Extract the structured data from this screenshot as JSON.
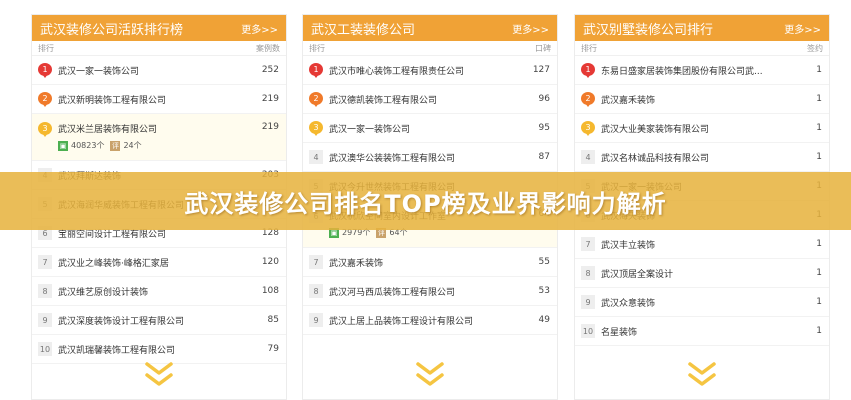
{
  "panels": [
    {
      "title": "武汉装修公司活跃排行榜",
      "more": "更多>>",
      "col_left": "排行",
      "col_right": "案例数",
      "rows": [
        {
          "rank": "1",
          "name": "武汉一家一装饰公司",
          "count": "252"
        },
        {
          "rank": "2",
          "name": "武汉新明装饰工程有限公司",
          "count": "219"
        },
        {
          "rank": "3",
          "name": "武汉米兰居装饰有限公司",
          "count": "219",
          "extra": {
            "views": "40823个",
            "comments": "24个"
          }
        },
        {
          "rank": "4",
          "name": "武汉拜斯达装饰",
          "count": "203"
        },
        {
          "rank": "5",
          "name": "武汉海润华威装饰工程有限公司",
          "count": "166"
        },
        {
          "rank": "6",
          "name": "宝丽空间设计工程有限公司",
          "count": "128"
        },
        {
          "rank": "7",
          "name": "武汉业之峰装饰·峰格汇家居",
          "count": "120"
        },
        {
          "rank": "8",
          "name": "武汉维艺原创设计装饰",
          "count": "108"
        },
        {
          "rank": "9",
          "name": "武汉深度装饰设计工程有限公司",
          "count": "85"
        },
        {
          "rank": "10",
          "name": "武汉凯瑞馨装饰工程有限公司",
          "count": "79"
        }
      ]
    },
    {
      "title": "武汉工装装修公司",
      "more": "更多>>",
      "col_left": "排行",
      "col_right": "口碑",
      "rows": [
        {
          "rank": "1",
          "name": "武汉市唯心装饰工程有限责任公司",
          "count": "127"
        },
        {
          "rank": "2",
          "name": "武汉德凯装饰工程有限公司",
          "count": "96"
        },
        {
          "rank": "3",
          "name": "武汉一家一装饰公司",
          "count": "95"
        },
        {
          "rank": "4",
          "name": "武汉澳华公装装饰工程有限公司",
          "count": "87"
        },
        {
          "rank": "5",
          "name": "武汉今升世然装饰工程有限公司",
          "count": ""
        },
        {
          "rank": "6",
          "name": "武汉杭欣空间室内设计工作室",
          "count": "64",
          "extra": {
            "views": "2979个",
            "comments": "64个"
          }
        },
        {
          "rank": "7",
          "name": "武汉嘉禾装饰",
          "count": "55"
        },
        {
          "rank": "8",
          "name": "武汉河马西瓜装饰工程有限公司",
          "count": "53"
        },
        {
          "rank": "9",
          "name": "武汉上居上品装饰工程设计有限公司",
          "count": "49"
        }
      ]
    },
    {
      "title": "武汉别墅装修公司排行",
      "more": "更多>>",
      "col_left": "排行",
      "col_right": "签约",
      "rows": [
        {
          "rank": "1",
          "name": "东易日盛家居装饰集团股份有限公司武...",
          "count": "1"
        },
        {
          "rank": "2",
          "name": "武汉嘉禾装饰",
          "count": "1"
        },
        {
          "rank": "3",
          "name": "武汉大业美家装饰有限公司",
          "count": "1"
        },
        {
          "rank": "4",
          "name": "武汉名林诚品科技有限公司",
          "count": "1"
        },
        {
          "rank": "5",
          "name": "武汉一家一装饰公司",
          "count": "1"
        },
        {
          "rank": "6",
          "name": "武汉海天装饰",
          "count": "1"
        },
        {
          "rank": "7",
          "name": "武汉丰立装饰",
          "count": "1"
        },
        {
          "rank": "8",
          "name": "武汉顶居全案设计",
          "count": "1"
        },
        {
          "rank": "9",
          "name": "武汉众意装饰",
          "count": "1"
        },
        {
          "rank": "10",
          "name": "名星装饰",
          "count": "1"
        }
      ]
    }
  ],
  "banner": {
    "title": "武汉装修公司排名TOP榜及业界影响力解析"
  },
  "colors": {
    "accent": "#f0a236",
    "rank1": "#e53935",
    "rank2": "#f07a2a",
    "rank3": "#f5b82e",
    "chevron": "#f5c542"
  },
  "icons": {
    "views": "image-icon",
    "comments": "comment-icon",
    "more": "chevron-double-down-icon"
  }
}
